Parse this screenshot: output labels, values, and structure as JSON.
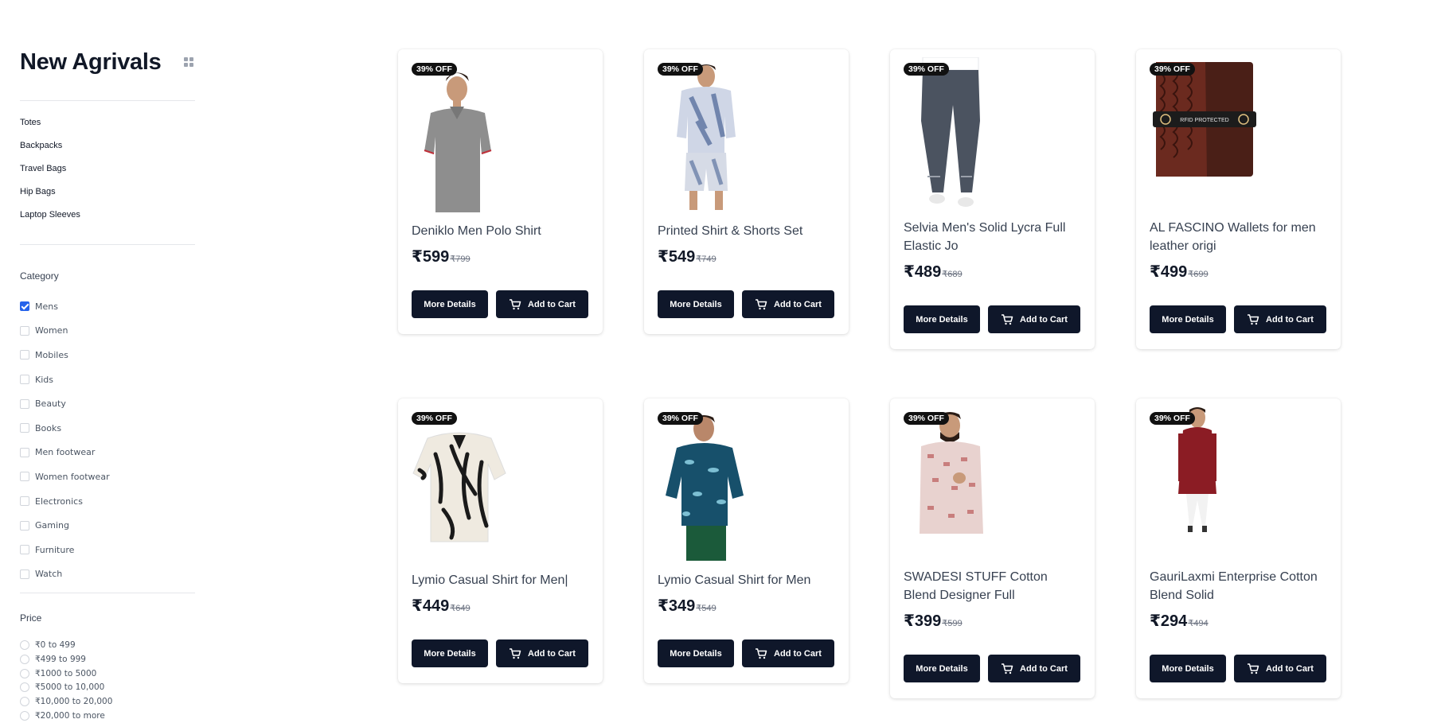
{
  "sidebar": {
    "title": "New Agrivals",
    "subcategories": [
      "Totes",
      "Backpacks",
      "Travel Bags",
      "Hip Bags",
      "Laptop Sleeves"
    ],
    "category_title": "Category",
    "categories": [
      {
        "label": "Mens",
        "checked": true
      },
      {
        "label": "Women",
        "checked": false
      },
      {
        "label": "Mobiles",
        "checked": false
      },
      {
        "label": "Kids",
        "checked": false
      },
      {
        "label": "Beauty",
        "checked": false
      },
      {
        "label": "Books",
        "checked": false
      },
      {
        "label": "Men footwear",
        "checked": false
      },
      {
        "label": "Women footwear",
        "checked": false
      },
      {
        "label": "Electronics",
        "checked": false
      },
      {
        "label": "Gaming",
        "checked": false
      },
      {
        "label": "Furniture",
        "checked": false
      },
      {
        "label": "Watch",
        "checked": false
      }
    ],
    "price_title": "Price",
    "price_ranges": [
      "₹0 to 499",
      "₹499 to 999",
      "₹1000 to 5000",
      "₹5000 to 10,000",
      "₹10,000 to 20,000",
      "₹20,000 to more"
    ]
  },
  "buttons": {
    "details_label": "More Details",
    "cart_label": "Add to Cart"
  },
  "products": [
    {
      "badge": "39% OFF",
      "name": "Deniklo Men Polo Shirt",
      "price": "₹599",
      "mrp": "₹799",
      "image": "grey-polo-shirt"
    },
    {
      "badge": "39% OFF",
      "name": "Printed Shirt & Shorts Set",
      "price": "₹549",
      "mrp": "₹749",
      "image": "printed-shirt-shorts"
    },
    {
      "badge": "39% OFF",
      "name": "Selvia Men's Solid Lycra Full Elastic Jo",
      "price": "₹489",
      "mrp": "₹689",
      "image": "grey-joggers"
    },
    {
      "badge": "39% OFF",
      "name": "AL FASCINO Wallets for men leather origi",
      "price": "₹499",
      "mrp": "₹699",
      "image": "leather-wallet",
      "image_text": "RFID PROTECTED"
    },
    {
      "badge": "39% OFF",
      "name": "Lymio Casual Shirt for Men|",
      "price": "₹449",
      "mrp": "₹649",
      "image": "black-white-shirt"
    },
    {
      "badge": "39% OFF",
      "name": "Lymio Casual Shirt for Men",
      "price": "₹349",
      "mrp": "₹549",
      "image": "blue-floral-shirt"
    },
    {
      "badge": "39% OFF",
      "name": "SWADESI STUFF Cotton Blend Designer Full",
      "price": "₹399",
      "mrp": "₹599",
      "image": "printed-kurta-shirt"
    },
    {
      "badge": "39% OFF",
      "name": "GauriLaxmi Enterprise Cotton Blend Solid",
      "price": "₹294",
      "mrp": "₹494",
      "image": "maroon-kurta"
    }
  ]
}
